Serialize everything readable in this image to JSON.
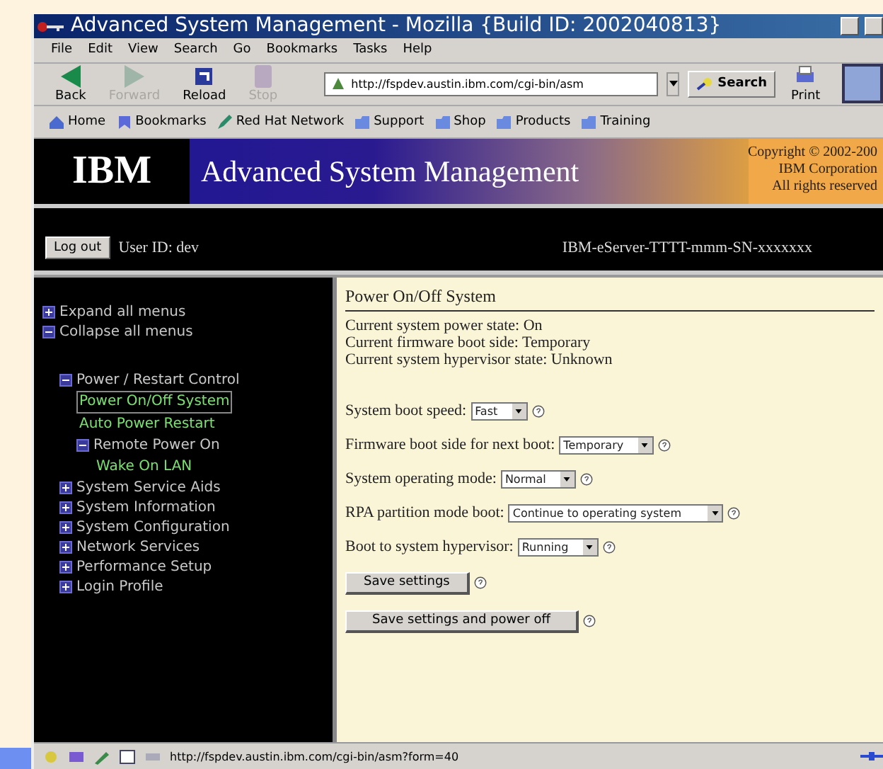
{
  "window": {
    "title": "Advanced System Management - Mozilla {Build ID: 2002040813}"
  },
  "menu": [
    "File",
    "Edit",
    "View",
    "Search",
    "Go",
    "Bookmarks",
    "Tasks",
    "Help"
  ],
  "toolbar": [
    {
      "label": "Back",
      "disabled": false,
      "kind": "back"
    },
    {
      "label": "Forward",
      "disabled": true,
      "kind": "forward"
    },
    {
      "label": "Reload",
      "disabled": false,
      "kind": "reload"
    },
    {
      "label": "Stop",
      "disabled": true,
      "kind": "stop"
    }
  ],
  "address": {
    "value": "http://fspdev.austin.ibm.com/cgi-bin/asm"
  },
  "search_button": "Search",
  "print_button": "Print",
  "bookmarks": [
    {
      "label": "Home",
      "kind": "home"
    },
    {
      "label": "Bookmarks",
      "kind": "bookmarks"
    },
    {
      "label": "Red Hat Network",
      "kind": "pen"
    },
    {
      "label": "Support",
      "kind": "folder"
    },
    {
      "label": "Shop",
      "kind": "folder"
    },
    {
      "label": "Products",
      "kind": "folder"
    },
    {
      "label": "Training",
      "kind": "folder"
    }
  ],
  "banner": {
    "logo": "IBM",
    "title": "Advanced System Management",
    "copyright": [
      "Copyright © 2002-200",
      "IBM Corporation",
      "All rights reserved"
    ]
  },
  "session": {
    "logout_button": "Log out",
    "user": "User ID: dev",
    "server": "IBM-eServer-TTTT-mmm-SN-xxxxxxx"
  },
  "sidebar": {
    "actions": [
      {
        "label": "Expand all menus",
        "kind": "expand"
      },
      {
        "label": "Collapse all menus",
        "kind": "collapse"
      }
    ],
    "tree": [
      {
        "label": "Power / Restart Control",
        "expanded": true,
        "children": [
          {
            "label": "Power On/Off System",
            "selected": true
          },
          {
            "label": "Auto Power Restart",
            "selected": false
          },
          {
            "label": "Remote Power On",
            "expanded": true,
            "children": [
              {
                "label": "Wake On LAN",
                "selected": false
              }
            ]
          }
        ]
      },
      {
        "label": "System Service Aids",
        "expanded": false
      },
      {
        "label": "System Information",
        "expanded": false
      },
      {
        "label": "System Configuration",
        "expanded": false
      },
      {
        "label": "Network Services",
        "expanded": false
      },
      {
        "label": "Performance Setup",
        "expanded": false
      },
      {
        "label": "Login Profile",
        "expanded": false
      }
    ]
  },
  "content": {
    "heading": "Power On/Off System",
    "status_lines": [
      "Current system power state: On",
      "Current firmware boot side: Temporary",
      "Current system hypervisor state: Unknown"
    ],
    "fields": [
      {
        "label": "System boot speed:",
        "value": "Fast"
      },
      {
        "label": "Firmware boot side for next boot:",
        "value": "Temporary"
      },
      {
        "label": "System operating mode:",
        "value": "Normal"
      },
      {
        "label": "RPA partition mode boot:",
        "value": "Continue to operating system"
      },
      {
        "label": "Boot to system hypervisor:",
        "value": "Running"
      }
    ],
    "buttons": [
      "Save settings",
      "Save settings and power off"
    ]
  },
  "status_bar": {
    "url": "http://fspdev.austin.ibm.com/cgi-bin/asm?form=40"
  }
}
